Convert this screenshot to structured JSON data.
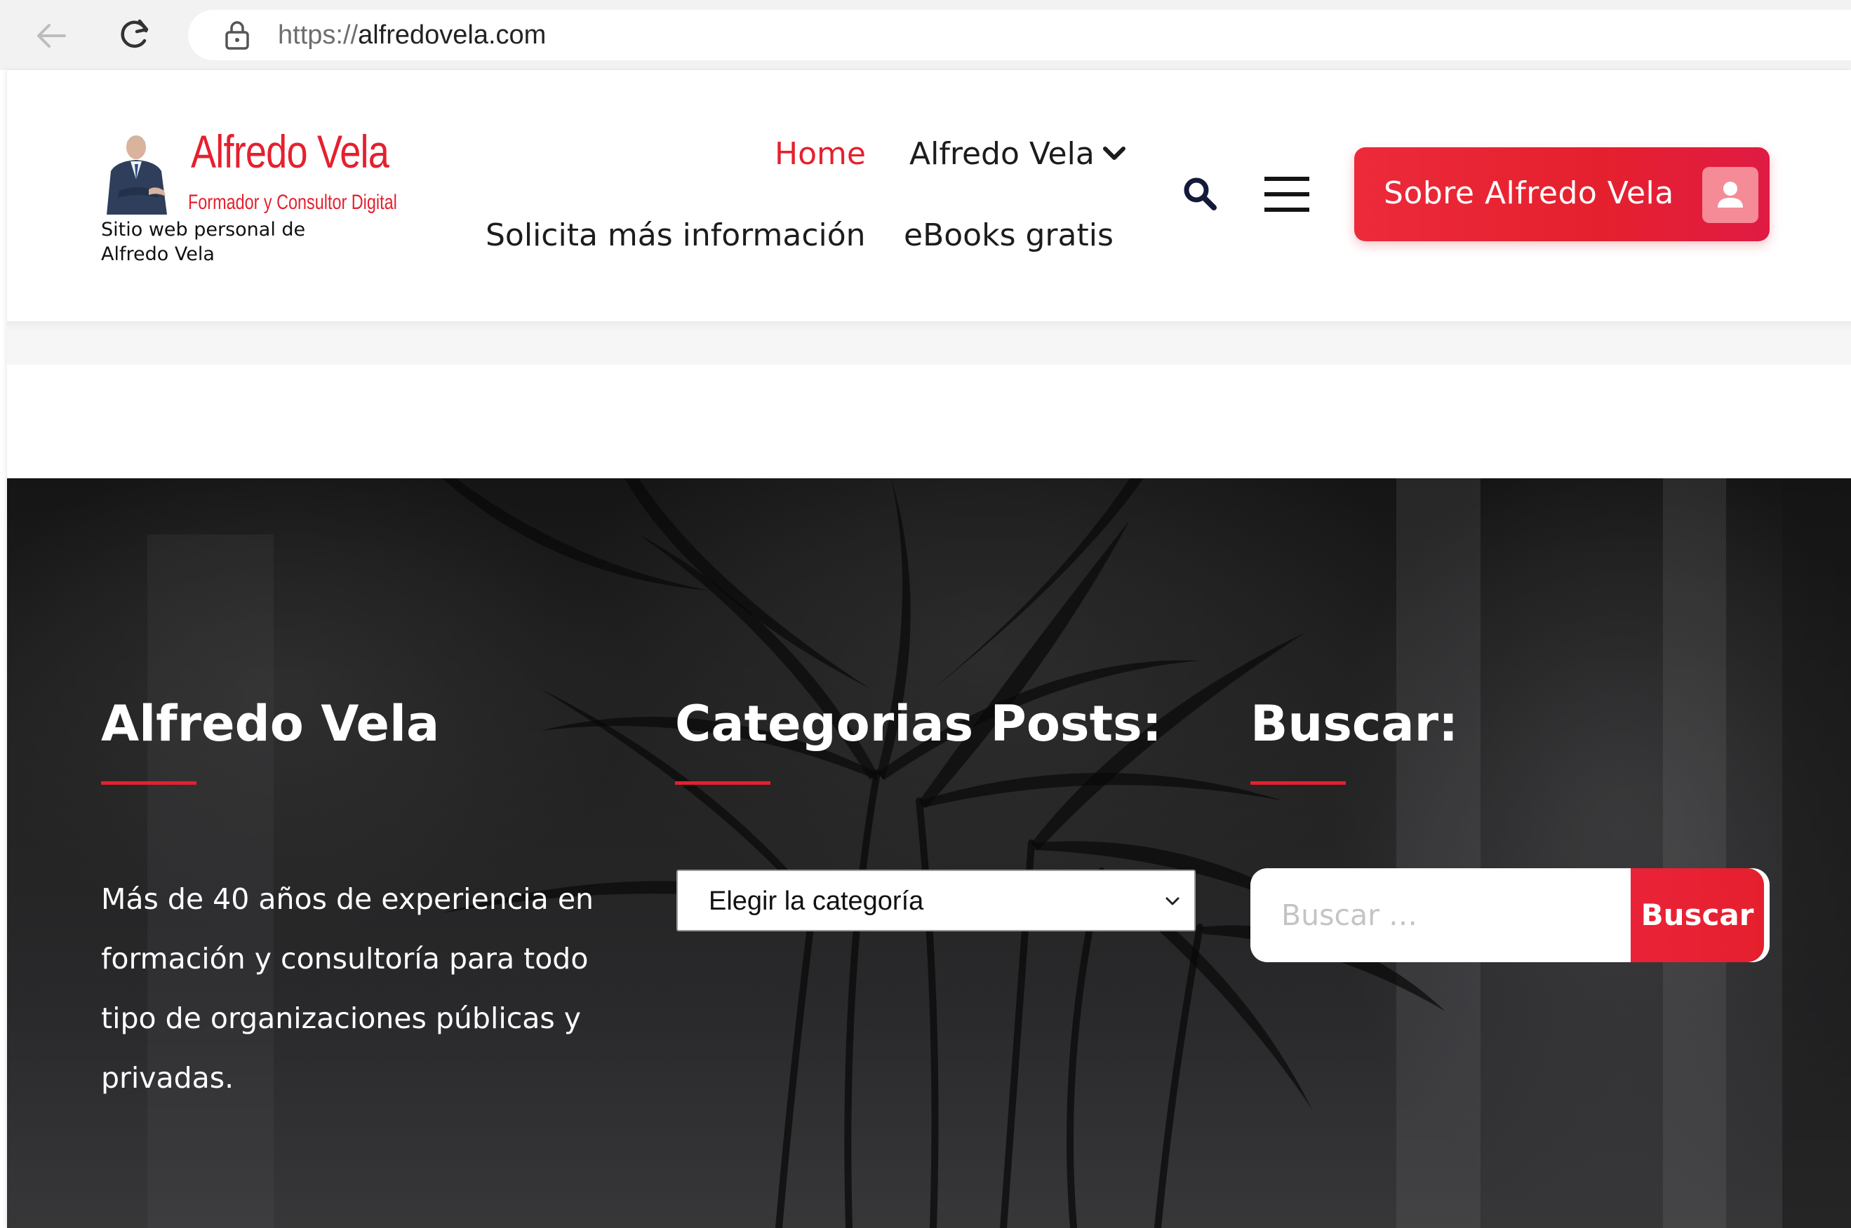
{
  "browser": {
    "url_scheme": "https://",
    "url_host": "alfredovela.com"
  },
  "header": {
    "logo": {
      "title": "Alfredo Vela",
      "subtitle": "Formador y Consultor Digital"
    },
    "tagline": "Sitio web personal de Alfredo Vela",
    "nav": {
      "home": "Home",
      "alfredo_vela": "Alfredo Vela",
      "info": "Solicita más información",
      "ebooks": "eBooks gratis"
    },
    "cta_label": "Sobre Alfredo Vela"
  },
  "footer": {
    "about": {
      "title": "Alfredo Vela",
      "text": "Más de 40 años de experiencia en formación y consultoría para todo tipo de organizaciones públicas y privadas."
    },
    "categories": {
      "title": "Categorias Posts:",
      "selected": "Elegir la categoría"
    },
    "search": {
      "title": "Buscar:",
      "placeholder": "Buscar …",
      "button": "Buscar"
    }
  },
  "colors": {
    "accent": "#e5202e",
    "text_dark": "#1c1c1c",
    "footer_bg": "#1f1f1f"
  },
  "icons": [
    "back-arrow-icon",
    "reload-icon",
    "lock-icon",
    "chevron-down-icon",
    "search-icon",
    "hamburger-menu-icon",
    "user-icon",
    "select-chevron-icon"
  ]
}
